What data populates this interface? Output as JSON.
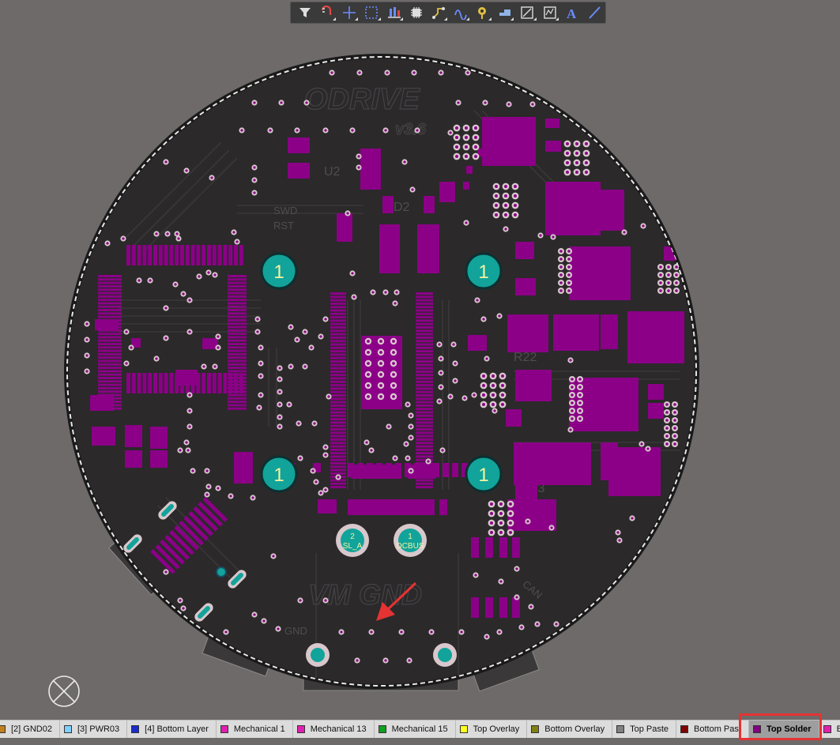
{
  "toolbar": {
    "buttons": [
      {
        "icon": "filter-icon",
        "has_menu": false
      },
      {
        "icon": "interactive-routing-icon",
        "has_menu": true
      },
      {
        "icon": "crosshair-icon",
        "has_menu": true
      },
      {
        "icon": "select-rectangle-icon",
        "has_menu": true
      },
      {
        "icon": "align-icon",
        "has_menu": true
      },
      {
        "icon": "place-component-icon",
        "has_menu": false
      },
      {
        "icon": "route-track-icon",
        "has_menu": true
      },
      {
        "icon": "diff-pair-route-icon",
        "has_menu": true
      },
      {
        "icon": "place-via-icon",
        "has_menu": true
      },
      {
        "icon": "place-polygon-icon",
        "has_menu": true
      },
      {
        "icon": "place-keepout-icon",
        "has_menu": true
      },
      {
        "icon": "place-string-icon",
        "has_menu": true
      },
      {
        "icon": "text-icon",
        "has_menu": false
      },
      {
        "icon": "line-icon",
        "has_menu": false
      }
    ]
  },
  "board": {
    "logo": "ODRIVE",
    "version": "v3.6",
    "labels": [
      "U2",
      "D2",
      "R22",
      "R23",
      "SWD",
      "RST",
      "GND",
      "VM GND",
      "CAN",
      "SL_A",
      "DCBUS"
    ],
    "mount_hole_label": "1",
    "connector_pins": [
      {
        "number": "2",
        "name": "SL_A"
      },
      {
        "number": "1",
        "name": "DCBUS"
      }
    ],
    "colors": {
      "background": "#6e6a69",
      "board": "#2b292a",
      "solder": "#8b0087",
      "pad_ring": "#d8c8cc",
      "hole": "#12a39a"
    }
  },
  "layer_tabs": [
    {
      "label": "[2] GND02",
      "color": "#c08020",
      "active": false
    },
    {
      "label": "[3] PWR03",
      "color": "#80d0ff",
      "active": false
    },
    {
      "label": "[4] Bottom Layer",
      "color": "#1a2ccc",
      "active": false
    },
    {
      "label": "Mechanical 1",
      "color": "#e020b0",
      "active": false
    },
    {
      "label": "Mechanical 13",
      "color": "#e020b0",
      "active": false
    },
    {
      "label": "Mechanical 15",
      "color": "#10a020",
      "active": false
    },
    {
      "label": "Top Overlay",
      "color": "#ffff20",
      "active": false
    },
    {
      "label": "Bottom Overlay",
      "color": "#808010",
      "active": false
    },
    {
      "label": "Top Paste",
      "color": "#808080",
      "active": false
    },
    {
      "label": "Bottom Past",
      "color": "#800000",
      "active": false
    },
    {
      "label": "Top Solder",
      "color": "#800080",
      "active": true
    },
    {
      "label": "Bo",
      "color": "#e020b0",
      "active": false
    }
  ]
}
